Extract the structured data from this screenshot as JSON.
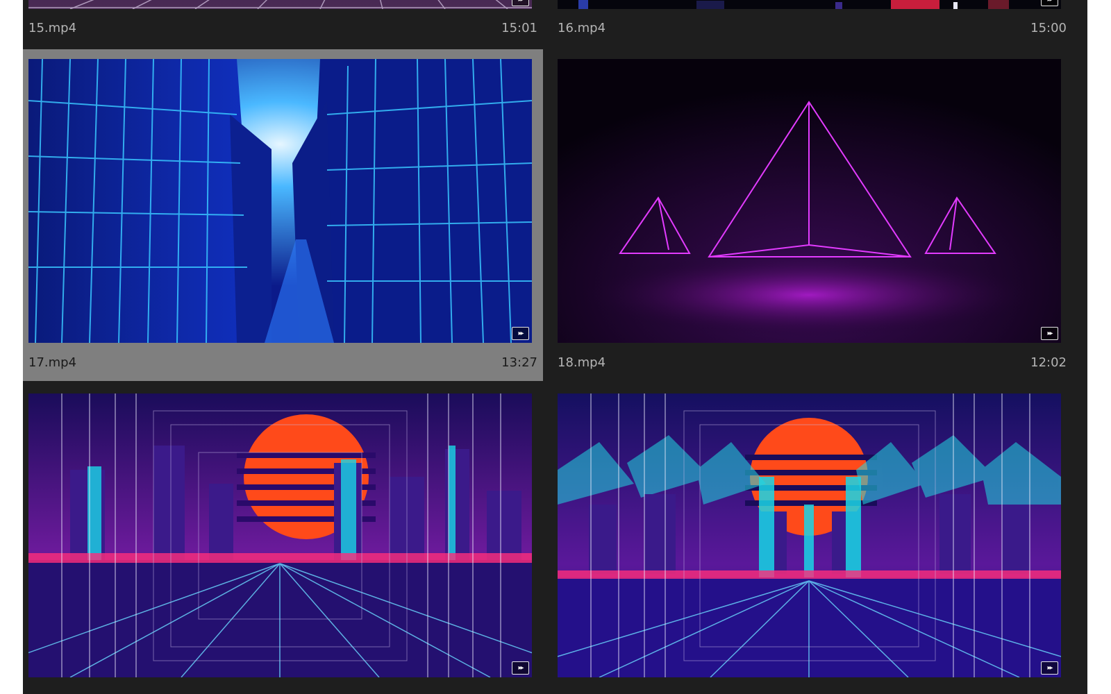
{
  "bin": {
    "clips": [
      {
        "name": "15.mp4",
        "duration": "15:01",
        "badge_icon": "audio-video-badge-icon"
      },
      {
        "name": "16.mp4",
        "duration": "15:00",
        "badge_icon": "audio-video-badge-icon"
      },
      {
        "name": "17.mp4",
        "duration": "13:27",
        "badge_icon": "audio-video-badge-icon",
        "selected": true
      },
      {
        "name": "18.mp4",
        "duration": "12:02",
        "badge_icon": "audio-video-badge-icon"
      },
      {
        "name": "",
        "duration": "",
        "badge_icon": "audio-video-badge-icon"
      },
      {
        "name": "",
        "duration": "",
        "badge_icon": "audio-video-badge-icon"
      }
    ]
  },
  "colors": {
    "panel_bg": "#1e1e1e",
    "selected_bg": "#7f7f7f",
    "text": "#b4b4b4"
  }
}
